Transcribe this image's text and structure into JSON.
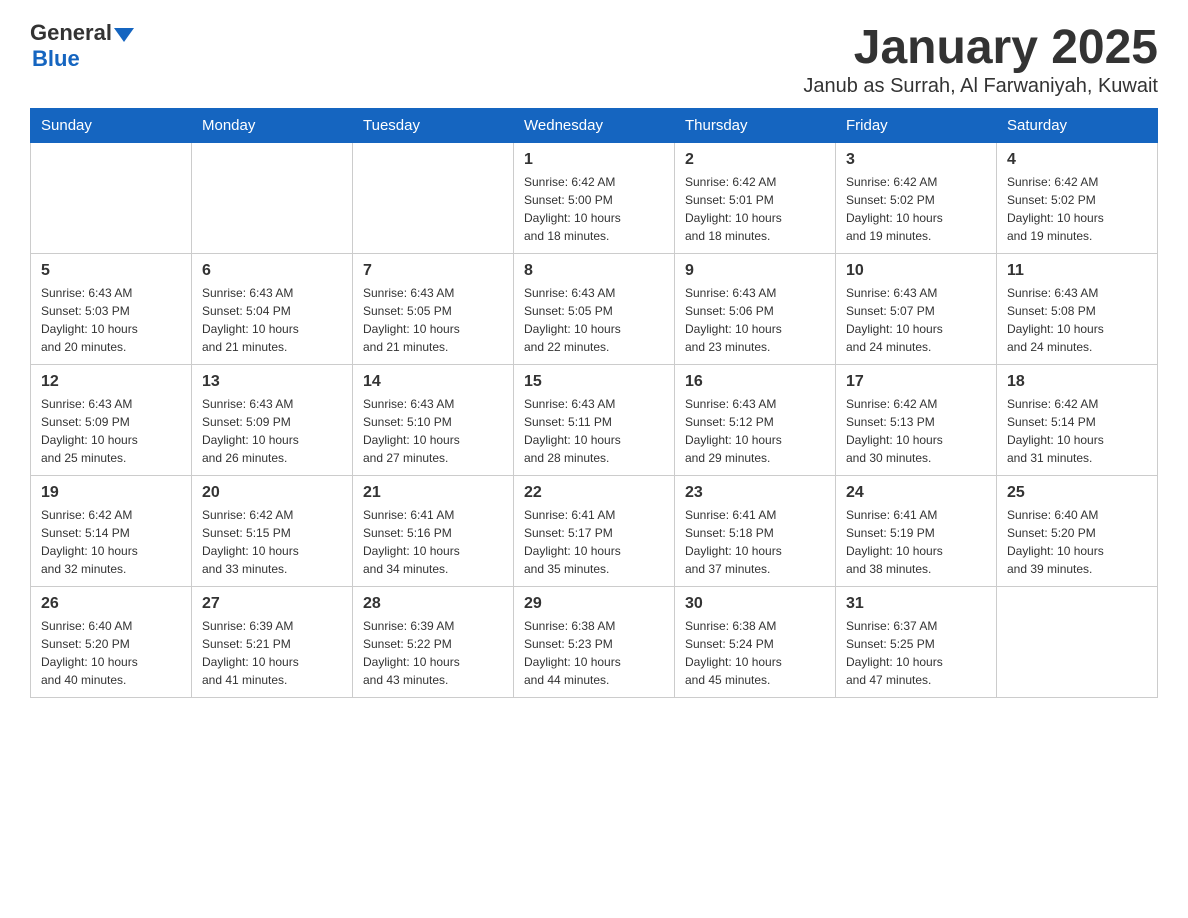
{
  "header": {
    "logo_general": "General",
    "logo_blue": "Blue",
    "month_year": "January 2025",
    "location": "Janub as Surrah, Al Farwaniyah, Kuwait"
  },
  "days_of_week": [
    "Sunday",
    "Monday",
    "Tuesday",
    "Wednesday",
    "Thursday",
    "Friday",
    "Saturday"
  ],
  "weeks": [
    [
      {
        "day": "",
        "info": ""
      },
      {
        "day": "",
        "info": ""
      },
      {
        "day": "",
        "info": ""
      },
      {
        "day": "1",
        "info": "Sunrise: 6:42 AM\nSunset: 5:00 PM\nDaylight: 10 hours\nand 18 minutes."
      },
      {
        "day": "2",
        "info": "Sunrise: 6:42 AM\nSunset: 5:01 PM\nDaylight: 10 hours\nand 18 minutes."
      },
      {
        "day": "3",
        "info": "Sunrise: 6:42 AM\nSunset: 5:02 PM\nDaylight: 10 hours\nand 19 minutes."
      },
      {
        "day": "4",
        "info": "Sunrise: 6:42 AM\nSunset: 5:02 PM\nDaylight: 10 hours\nand 19 minutes."
      }
    ],
    [
      {
        "day": "5",
        "info": "Sunrise: 6:43 AM\nSunset: 5:03 PM\nDaylight: 10 hours\nand 20 minutes."
      },
      {
        "day": "6",
        "info": "Sunrise: 6:43 AM\nSunset: 5:04 PM\nDaylight: 10 hours\nand 21 minutes."
      },
      {
        "day": "7",
        "info": "Sunrise: 6:43 AM\nSunset: 5:05 PM\nDaylight: 10 hours\nand 21 minutes."
      },
      {
        "day": "8",
        "info": "Sunrise: 6:43 AM\nSunset: 5:05 PM\nDaylight: 10 hours\nand 22 minutes."
      },
      {
        "day": "9",
        "info": "Sunrise: 6:43 AM\nSunset: 5:06 PM\nDaylight: 10 hours\nand 23 minutes."
      },
      {
        "day": "10",
        "info": "Sunrise: 6:43 AM\nSunset: 5:07 PM\nDaylight: 10 hours\nand 24 minutes."
      },
      {
        "day": "11",
        "info": "Sunrise: 6:43 AM\nSunset: 5:08 PM\nDaylight: 10 hours\nand 24 minutes."
      }
    ],
    [
      {
        "day": "12",
        "info": "Sunrise: 6:43 AM\nSunset: 5:09 PM\nDaylight: 10 hours\nand 25 minutes."
      },
      {
        "day": "13",
        "info": "Sunrise: 6:43 AM\nSunset: 5:09 PM\nDaylight: 10 hours\nand 26 minutes."
      },
      {
        "day": "14",
        "info": "Sunrise: 6:43 AM\nSunset: 5:10 PM\nDaylight: 10 hours\nand 27 minutes."
      },
      {
        "day": "15",
        "info": "Sunrise: 6:43 AM\nSunset: 5:11 PM\nDaylight: 10 hours\nand 28 minutes."
      },
      {
        "day": "16",
        "info": "Sunrise: 6:43 AM\nSunset: 5:12 PM\nDaylight: 10 hours\nand 29 minutes."
      },
      {
        "day": "17",
        "info": "Sunrise: 6:42 AM\nSunset: 5:13 PM\nDaylight: 10 hours\nand 30 minutes."
      },
      {
        "day": "18",
        "info": "Sunrise: 6:42 AM\nSunset: 5:14 PM\nDaylight: 10 hours\nand 31 minutes."
      }
    ],
    [
      {
        "day": "19",
        "info": "Sunrise: 6:42 AM\nSunset: 5:14 PM\nDaylight: 10 hours\nand 32 minutes."
      },
      {
        "day": "20",
        "info": "Sunrise: 6:42 AM\nSunset: 5:15 PM\nDaylight: 10 hours\nand 33 minutes."
      },
      {
        "day": "21",
        "info": "Sunrise: 6:41 AM\nSunset: 5:16 PM\nDaylight: 10 hours\nand 34 minutes."
      },
      {
        "day": "22",
        "info": "Sunrise: 6:41 AM\nSunset: 5:17 PM\nDaylight: 10 hours\nand 35 minutes."
      },
      {
        "day": "23",
        "info": "Sunrise: 6:41 AM\nSunset: 5:18 PM\nDaylight: 10 hours\nand 37 minutes."
      },
      {
        "day": "24",
        "info": "Sunrise: 6:41 AM\nSunset: 5:19 PM\nDaylight: 10 hours\nand 38 minutes."
      },
      {
        "day": "25",
        "info": "Sunrise: 6:40 AM\nSunset: 5:20 PM\nDaylight: 10 hours\nand 39 minutes."
      }
    ],
    [
      {
        "day": "26",
        "info": "Sunrise: 6:40 AM\nSunset: 5:20 PM\nDaylight: 10 hours\nand 40 minutes."
      },
      {
        "day": "27",
        "info": "Sunrise: 6:39 AM\nSunset: 5:21 PM\nDaylight: 10 hours\nand 41 minutes."
      },
      {
        "day": "28",
        "info": "Sunrise: 6:39 AM\nSunset: 5:22 PM\nDaylight: 10 hours\nand 43 minutes."
      },
      {
        "day": "29",
        "info": "Sunrise: 6:38 AM\nSunset: 5:23 PM\nDaylight: 10 hours\nand 44 minutes."
      },
      {
        "day": "30",
        "info": "Sunrise: 6:38 AM\nSunset: 5:24 PM\nDaylight: 10 hours\nand 45 minutes."
      },
      {
        "day": "31",
        "info": "Sunrise: 6:37 AM\nSunset: 5:25 PM\nDaylight: 10 hours\nand 47 minutes."
      },
      {
        "day": "",
        "info": ""
      }
    ]
  ]
}
